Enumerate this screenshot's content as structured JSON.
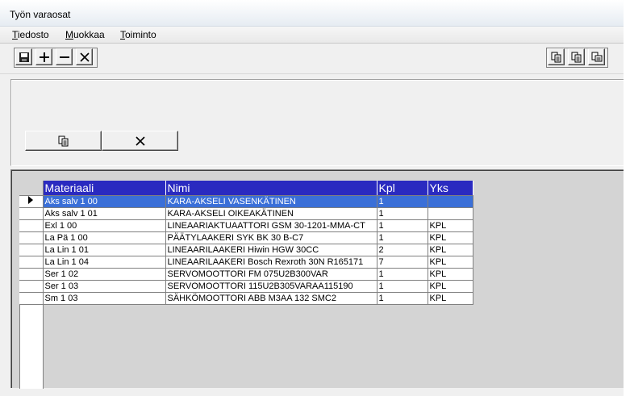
{
  "window": {
    "title": "Työn varaosat"
  },
  "menu": [
    "Tiedosto",
    "Muokkaa",
    "Toiminto"
  ],
  "toolbar": {
    "left_icons": [
      "save-icon",
      "plus-icon",
      "minus-icon",
      "close-icon"
    ],
    "right_icons": [
      "copy-icon",
      "paste-icon",
      "paste-special-icon"
    ]
  },
  "panel": {
    "buttons": [
      "copy-icon",
      "close-icon"
    ]
  },
  "grid": {
    "columns": [
      "Materiaali",
      "Nimi",
      "Kpl",
      "Yks"
    ],
    "selected_row": 0,
    "rows": [
      [
        "Aks salv 1 00",
        "KARA-AKSELI VASENKÄTINEN",
        "1",
        ""
      ],
      [
        "Aks salv 1 01",
        "KARA-AKSELI OIKEAKÄTINEN",
        "1",
        ""
      ],
      [
        "Exl 1 00",
        "LINEAARIAKTUAATTORI GSM 30-1201-MMA-CT",
        "1",
        "KPL"
      ],
      [
        "La  Pä 1 00",
        "PÄÄTYLAAKERI SYK BK 30 B-C7",
        "1",
        "KPL"
      ],
      [
        "La Lin 1 01",
        "LINEAARILAAKERI Hiwin HGW 30CC",
        "2",
        "KPL"
      ],
      [
        "La Lin 1 04",
        "LINEAARILAAKERI Bosch Rexroth 30N R165171",
        "7",
        "KPL"
      ],
      [
        "Ser 1 02",
        "SERVOMOOTTORI FM 075U2B300VAR",
        "1",
        "KPL"
      ],
      [
        "Ser 1 03",
        "SERVOMOOTTORI 115U2B305VARAA115190",
        "1",
        "KPL"
      ],
      [
        "Sm 1 03",
        "SÄHKÖMOOTTORI ABB M3AA 132 SMC2",
        "1",
        "KPL"
      ]
    ]
  }
}
